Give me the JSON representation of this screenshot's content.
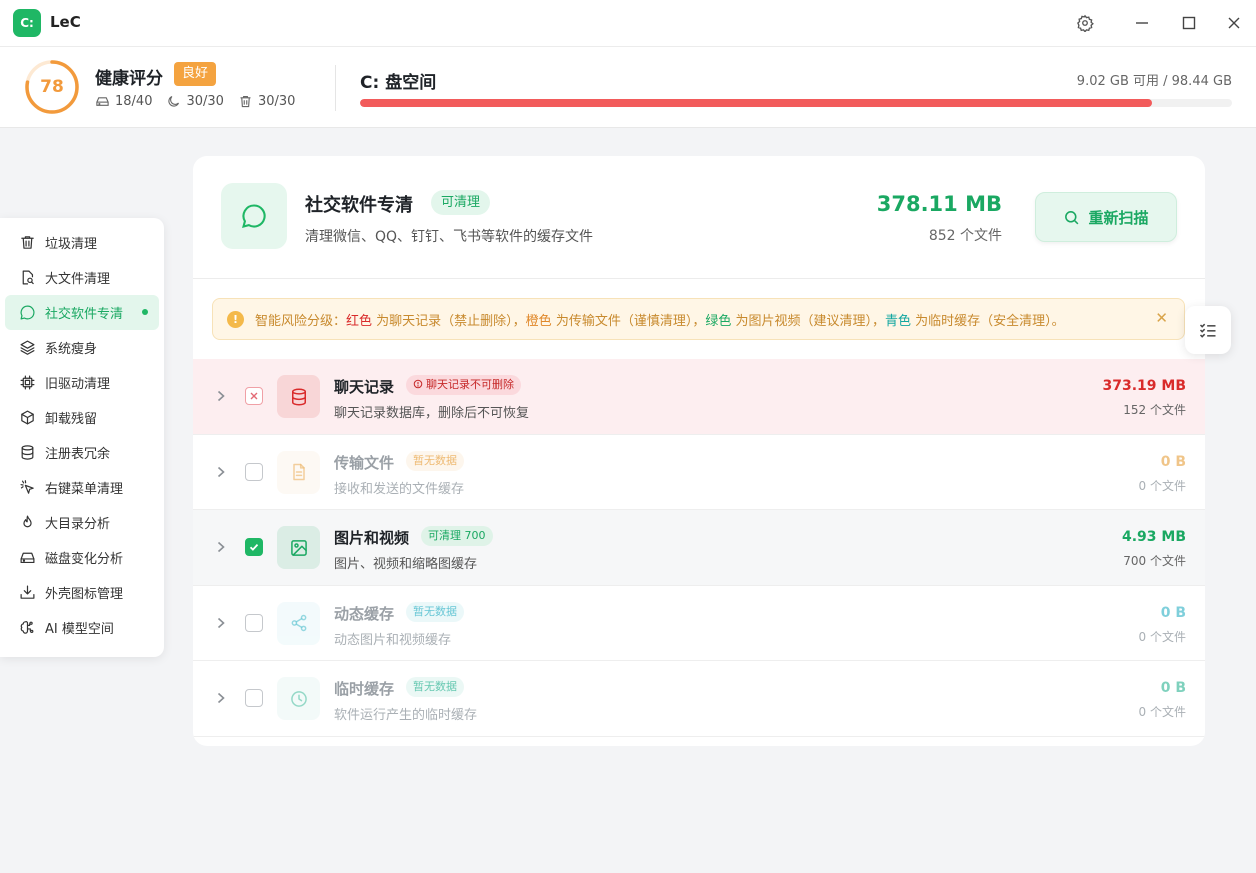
{
  "app": {
    "logo": "C:",
    "title": "LeC"
  },
  "window_controls": {
    "icons": [
      "gear-icon",
      "minimize-icon",
      "maximize-icon",
      "close-icon"
    ]
  },
  "header": {
    "score": "78",
    "score_fraction": 0.78,
    "health_title": "健康评分",
    "health_badge": "良好",
    "stats": [
      {
        "icon": "disk-icon",
        "value": "18/40"
      },
      {
        "icon": "moon-icon",
        "value": "30/30"
      },
      {
        "icon": "trash-icon",
        "value": "30/30"
      }
    ],
    "disk_title": "C: 盘空间",
    "disk_info": "9.02 GB 可用 / 98.44 GB",
    "disk_used_fraction": 0.908
  },
  "sidebar": {
    "items": [
      {
        "label": "垃圾清理",
        "icon": "trash-icon",
        "active": false
      },
      {
        "label": "大文件清理",
        "icon": "file-search-icon",
        "active": false
      },
      {
        "label": "社交软件专清",
        "icon": "chat-bubble-icon",
        "active": true
      },
      {
        "label": "系统瘦身",
        "icon": "layers-icon",
        "active": false
      },
      {
        "label": "旧驱动清理",
        "icon": "chip-icon",
        "active": false
      },
      {
        "label": "卸载残留",
        "icon": "box-icon",
        "active": false
      },
      {
        "label": "注册表冗余",
        "icon": "database-icon",
        "active": false
      },
      {
        "label": "右键菜单清理",
        "icon": "cursor-click-icon",
        "active": false
      },
      {
        "label": "大目录分析",
        "icon": "flame-icon",
        "active": false
      },
      {
        "label": "磁盘变化分析",
        "icon": "hard-drive-icon",
        "active": false
      },
      {
        "label": "外壳图标管理",
        "icon": "download-tray-icon",
        "active": false
      },
      {
        "label": "AI 模型空间",
        "icon": "brain-icon",
        "active": false
      }
    ]
  },
  "card": {
    "title": "社交软件专清",
    "badge": "可清理",
    "description": "清理微信、QQ、钉钉、飞书等软件的缓存文件",
    "total_size": "378.11 MB",
    "total_files": "852 个文件",
    "rescan_label": "重新扫描"
  },
  "warning": {
    "prefix": "智能风险分级：",
    "red_word": "红色",
    "red_text": " 为聊天记录（禁止删除），",
    "orange_word": "橙色",
    "orange_text": " 为传输文件（谨慎清理），",
    "green_word": "绿色",
    "green_text": " 为图片视频（建议清理），",
    "cyan_word": "青色",
    "cyan_text": " 为临时缓存（安全清理）。",
    "close": "✕"
  },
  "rows": [
    {
      "title": "聊天记录",
      "tag": "聊天记录不可删除",
      "description": "聊天记录数据库，删除后不可恢复",
      "size": "373.19 MB",
      "files": "152 个文件",
      "state": "locked",
      "icon": "database-icon",
      "color": "#d92b2b"
    },
    {
      "title": "传输文件",
      "tag": "暂无数据",
      "description": "接收和发送的文件缓存",
      "size": "0 B",
      "files": "0 个文件",
      "state": "empty",
      "icon": "document-icon",
      "color": "#e8a64a"
    },
    {
      "title": "图片和视频",
      "tag": "可清理 700",
      "description": "图片、视频和缩略图缓存",
      "size": "4.93 MB",
      "files": "700 个文件",
      "state": "checked",
      "icon": "image-icon",
      "color": "#1aa862"
    },
    {
      "title": "动态缓存",
      "tag": "暂无数据",
      "description": "动态图片和视频缓存",
      "size": "0 B",
      "files": "0 个文件",
      "state": "empty",
      "icon": "share-icon",
      "color": "#3bb6c8"
    },
    {
      "title": "临时缓存",
      "tag": "暂无数据",
      "description": "软件运行产生的临时缓存",
      "size": "0 B",
      "files": "0 个文件",
      "state": "empty",
      "icon": "clock-icon",
      "color": "#3ab89a"
    }
  ]
}
